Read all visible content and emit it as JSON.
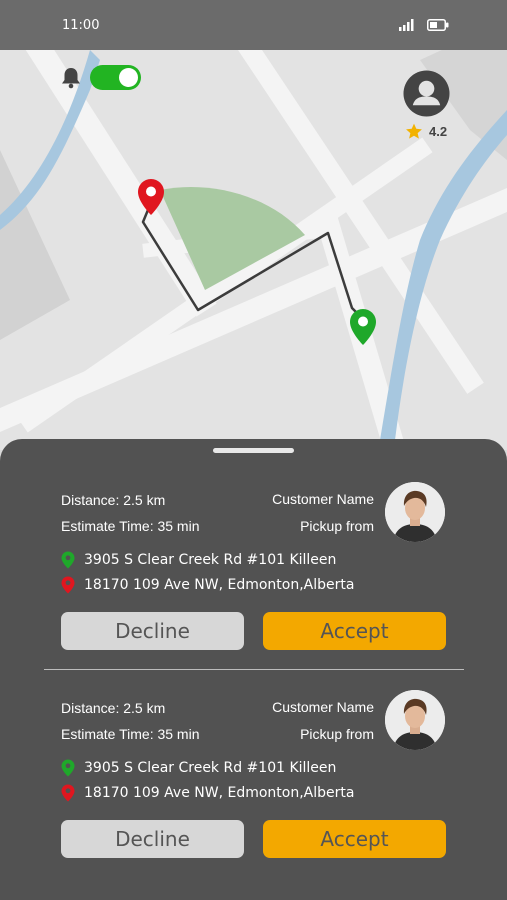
{
  "status_bar": {
    "time": "11:00"
  },
  "map": {
    "online_toggle_on": true,
    "profile": {
      "rating": "4.2"
    }
  },
  "requests": [
    {
      "distance": "Distance: 2.5 km",
      "estimate_time": "Estimate Time: 35 min",
      "customer_name": "Customer Name",
      "pickup_label": "Pickup from",
      "pickup_address": "3905 S Clear Creek Rd #101 Killeen",
      "dropoff_address": "18170 109 Ave NW, Edmonton,Alberta",
      "decline_label": "Decline",
      "accept_label": "Accept"
    },
    {
      "distance": "Distance: 2.5 km",
      "estimate_time": "Estimate Time: 35 min",
      "customer_name": "Customer Name",
      "pickup_label": "Pickup from",
      "pickup_address": "3905 S Clear Creek Rd #101 Killeen",
      "dropoff_address": "18170 109 Ave NW, Edmonton,Alberta",
      "decline_label": "Decline",
      "accept_label": "Accept"
    }
  ],
  "colors": {
    "accept": "#f3a800",
    "decline": "#d7d7d7",
    "sheet": "#525252",
    "toggle_on": "#22b422",
    "pickup_pin": "#1fa82a",
    "dropoff_pin": "#e0161f",
    "water": "#a7c7df",
    "park": "#a9c9a2",
    "rating_star": "#f2b200"
  },
  "icons": {
    "bell": "bell-icon",
    "avatar": "user-avatar-icon",
    "star": "star-icon",
    "signal": "signal-icon",
    "battery": "battery-icon",
    "pickup": "map-pin-green-icon",
    "dropoff": "map-pin-red-icon"
  }
}
